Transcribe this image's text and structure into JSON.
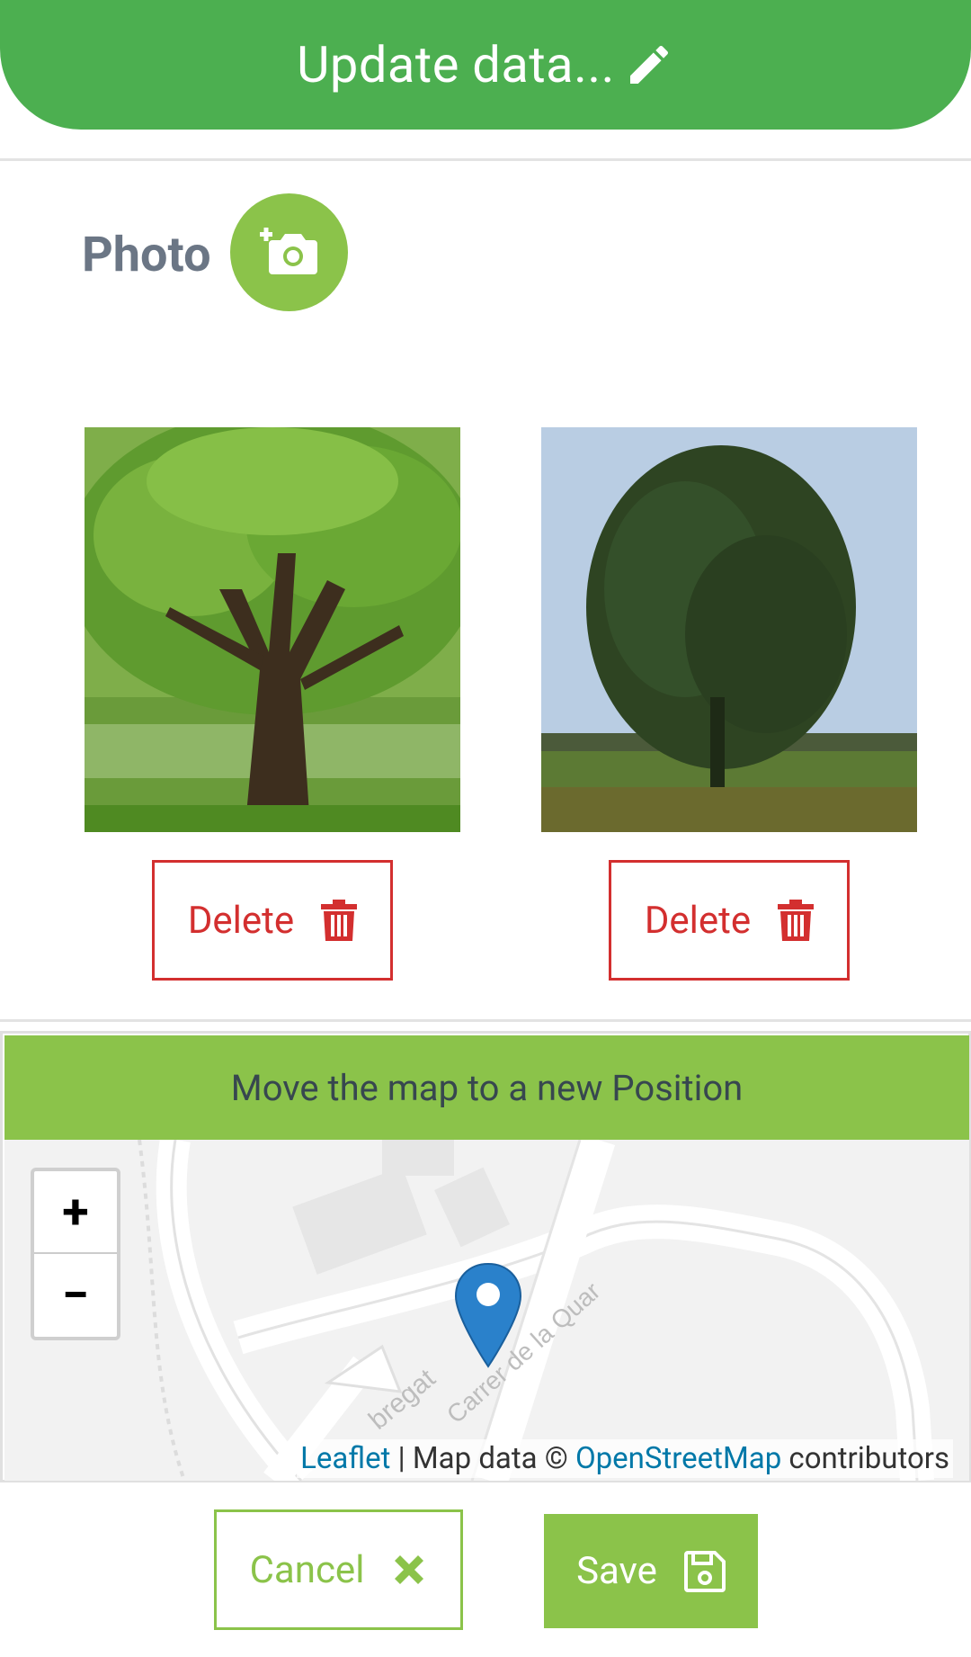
{
  "header": {
    "title": "Update data...",
    "icon": "pencil-icon"
  },
  "photo": {
    "label": "Photo",
    "add_icon": "camera-plus-icon"
  },
  "photos": [
    {
      "delete_label": "Delete",
      "icon": "trash-icon"
    },
    {
      "delete_label": "Delete",
      "icon": "trash-icon"
    }
  ],
  "map": {
    "header": "Move the map to a new Position",
    "zoom_in": "+",
    "zoom_out": "−",
    "road_labels": [
      "Carrer de la Quar",
      "bregat"
    ],
    "attribution": {
      "leaflet": "Leaflet",
      "separator": " | Map data © ",
      "osm": "OpenStreetMap",
      "suffix": " contributors"
    }
  },
  "actions": {
    "cancel_label": "Cancel",
    "save_label": "Save"
  },
  "colors": {
    "header_green": "#4caf50",
    "accent_green": "#8bc34a",
    "danger_red": "#d32f2f",
    "marker_blue": "#2a81cb"
  }
}
